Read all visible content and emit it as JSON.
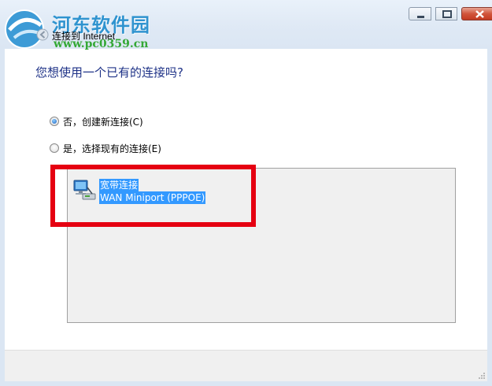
{
  "watermark": {
    "name": "河东软件园",
    "url": "www.pc0359.cn"
  },
  "window": {
    "title": "连接到 Internet"
  },
  "dialog": {
    "question": "您想使用一个已有的连接吗?",
    "options": [
      {
        "label": "否，创建新连接(C)",
        "checked": true
      },
      {
        "label": "是，选择现有的连接(E)",
        "checked": false
      }
    ],
    "connection": {
      "name": "宽带连接",
      "device": "WAN Miniport (PPPOE)"
    }
  },
  "colors": {
    "highlight": "#e50011",
    "selection": "#3399ff",
    "question_text": "#1e3287"
  }
}
